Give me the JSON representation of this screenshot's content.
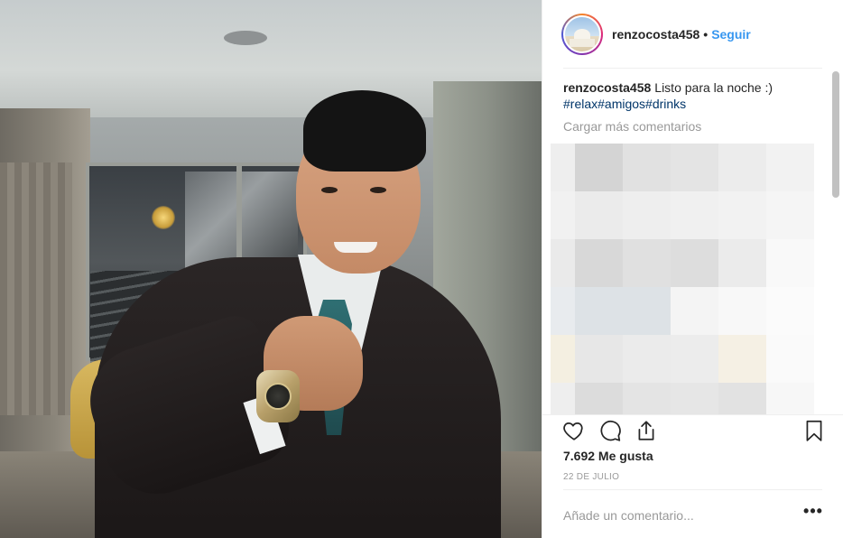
{
  "post": {
    "author": "renzocosta458",
    "follow_label": "Seguir",
    "separator": "•",
    "caption_text": "Listo para la noche :)",
    "hashtags": "#relax#amigos#drinks",
    "load_more_label": "Cargar más comentarios",
    "likes": "7.692 Me gusta",
    "date": "22 DE JULIO",
    "comment_placeholder": "Añade un comentario...",
    "more_label": "•••"
  },
  "icons": {
    "like": "heart-icon",
    "comment": "comment-bubble-icon",
    "share": "share-icon",
    "save": "bookmark-icon"
  },
  "colors": {
    "link_blue": "#3897f0",
    "hashtag_blue": "#003569",
    "muted": "#999999",
    "text": "#262626"
  }
}
